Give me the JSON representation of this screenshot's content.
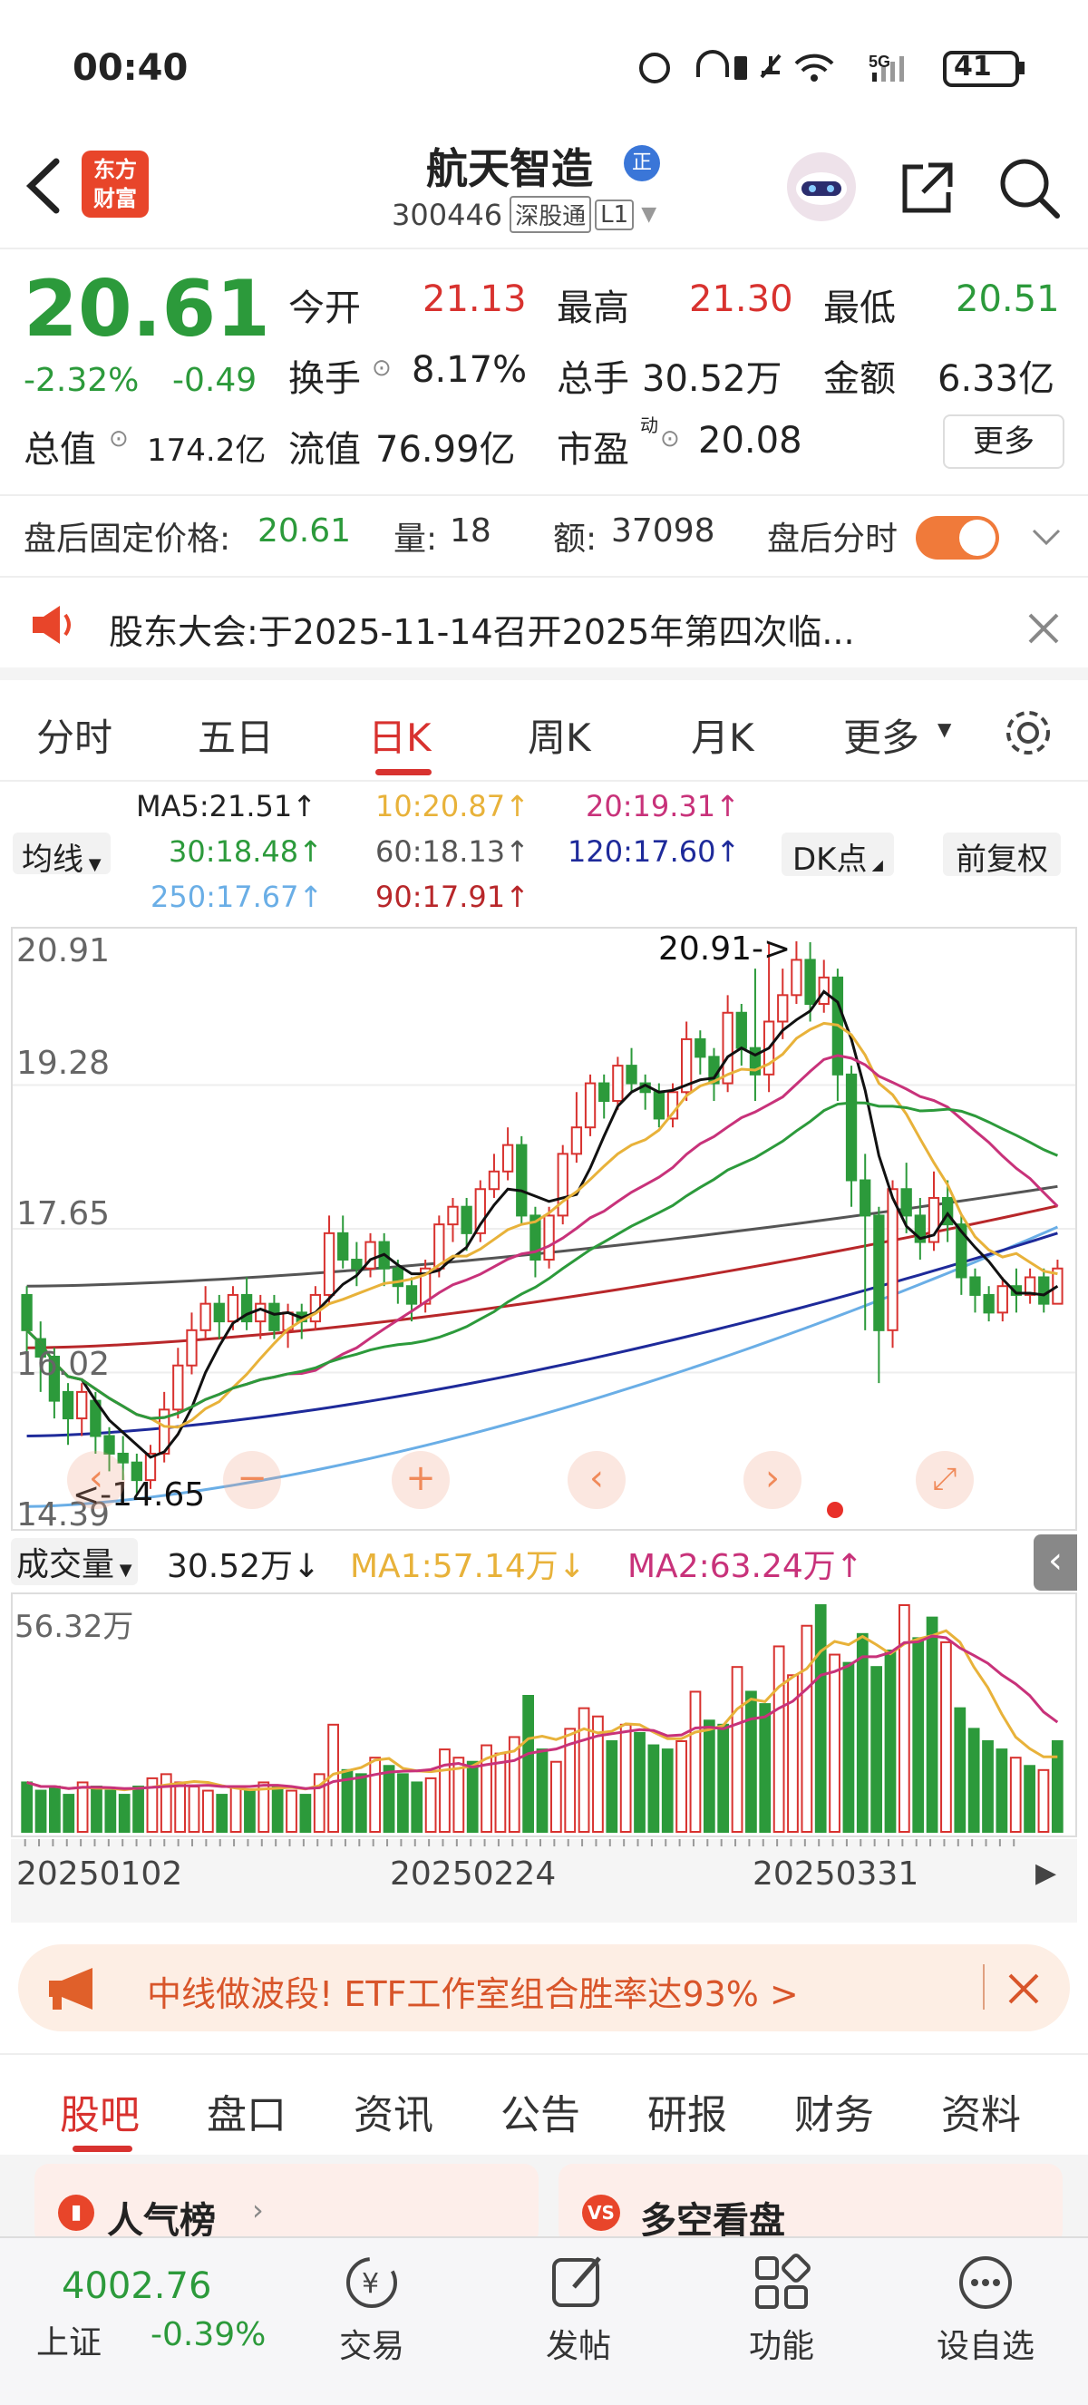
{
  "status": {
    "time": "00:40",
    "battery": "41"
  },
  "header": {
    "logo_line1": "东方",
    "logo_line2": "财富",
    "title": "航天智造",
    "badge": "正",
    "code": "300446",
    "tag1": "深股通",
    "tag2": "L1"
  },
  "quote": {
    "price": "20.61",
    "pct": "-2.32%",
    "chg": "-0.49",
    "open_label": "今开",
    "open": "21.13",
    "high_label": "最高",
    "high": "21.30",
    "low_label": "最低",
    "low": "20.51",
    "turnover_label": "换手",
    "turnover": "8.17%",
    "vol_label": "总手",
    "vol": "30.52万",
    "amount_label": "金额",
    "amount": "6.33亿",
    "mcap_label": "总值",
    "mcap": "174.2亿",
    "float_label": "流值",
    "float": "76.99亿",
    "pe_label": "市盈",
    "pe_sup": "动",
    "pe": "20.08",
    "more": "更多"
  },
  "afterhours": {
    "label": "盘后固定价格:",
    "price": "20.61",
    "vol_label": "量:",
    "vol": "18",
    "amt_label": "额:",
    "amt": "37098",
    "toggle_label": "盘后分时"
  },
  "notice": {
    "text": "股东大会:于2025-11-14召开2025年第四次临..."
  },
  "tabs": {
    "t1": "分时",
    "t2": "五日",
    "t3": "日K",
    "t4": "周K",
    "t5": "月K",
    "t6": "更多"
  },
  "ma": {
    "select": "均线",
    "ma5": "MA5:21.51↑",
    "ma10": "10:20.87↑",
    "ma20": "20:19.31↑",
    "ma30": "30:18.48↑",
    "ma60": "60:18.13↑",
    "ma120": "120:17.60↑",
    "ma250": "250:17.67↑",
    "ma90": "90:17.91↑",
    "dk": "DK点",
    "fq": "前复权"
  },
  "chart_labels": {
    "y1": "20.91",
    "y2": "19.28",
    "y3": "17.65",
    "y4": "16.02",
    "y5": "14.39",
    "maxnote": "20.91->",
    "minnote": "<-14.65"
  },
  "volume": {
    "select": "成交量",
    "val": "30.52万↓",
    "ma1": "MA1:57.14万↓",
    "ma2": "MA2:63.24万↑",
    "ymax": "56.32万",
    "d1": "20250102",
    "d2": "20250224",
    "d3": "20250331"
  },
  "banner": {
    "text": "中线做波段! ETF工作室组合胜率达93% >"
  },
  "subtabs": {
    "s1": "股吧",
    "s2": "盘口",
    "s3": "资讯",
    "s4": "公告",
    "s5": "研报",
    "s6": "财务",
    "s7": "资料"
  },
  "cards": {
    "c1": "人气榜",
    "c2": "多空看盘"
  },
  "bottom": {
    "index_val": "4002.76",
    "index_name": "上证",
    "index_chg": "-0.39%",
    "b1": "交易",
    "b2": "发帖",
    "b3": "功能",
    "b4": "设自选"
  },
  "chart_data": {
    "type": "candlestick",
    "ohlc": [
      [
        16.9,
        16.5,
        17.0,
        16.1
      ],
      [
        16.4,
        16.2,
        16.6,
        15.8
      ],
      [
        16.2,
        15.7,
        16.3,
        15.5
      ],
      [
        15.8,
        15.5,
        15.9,
        15.2
      ],
      [
        15.5,
        15.8,
        15.9,
        15.3
      ],
      [
        15.7,
        15.3,
        15.8,
        15.1
      ],
      [
        15.3,
        15.1,
        15.4,
        14.9
      ],
      [
        15.1,
        15.0,
        15.3,
        14.8
      ],
      [
        15.0,
        14.8,
        15.1,
        14.65
      ],
      [
        14.8,
        15.1,
        15.2,
        14.7
      ],
      [
        15.1,
        15.6,
        15.8,
        15.0
      ],
      [
        15.6,
        16.1,
        16.3,
        15.5
      ],
      [
        16.1,
        16.5,
        16.7,
        16.0
      ],
      [
        16.5,
        16.8,
        17.0,
        16.4
      ],
      [
        16.8,
        16.6,
        16.9,
        16.4
      ],
      [
        16.6,
        16.9,
        17.0,
        16.5
      ],
      [
        16.9,
        16.6,
        17.1,
        16.5
      ],
      [
        16.6,
        16.8,
        16.9,
        16.4
      ],
      [
        16.8,
        16.5,
        16.9,
        16.4
      ],
      [
        16.5,
        16.7,
        16.8,
        16.3
      ],
      [
        16.7,
        16.6,
        16.8,
        16.4
      ],
      [
        16.6,
        16.9,
        17.0,
        16.5
      ],
      [
        16.9,
        17.6,
        17.8,
        16.8
      ],
      [
        17.6,
        17.3,
        17.8,
        17.2
      ],
      [
        17.3,
        17.2,
        17.5,
        17.0
      ],
      [
        17.2,
        17.5,
        17.6,
        17.1
      ],
      [
        17.5,
        17.2,
        17.6,
        17.0
      ],
      [
        17.2,
        17.0,
        17.3,
        16.8
      ],
      [
        17.0,
        16.8,
        17.1,
        16.6
      ],
      [
        16.8,
        17.2,
        17.3,
        16.7
      ],
      [
        17.2,
        17.7,
        17.8,
        17.1
      ],
      [
        17.7,
        17.9,
        18.0,
        17.5
      ],
      [
        17.9,
        17.6,
        18.0,
        17.4
      ],
      [
        17.6,
        18.1,
        18.2,
        17.5
      ],
      [
        18.1,
        18.3,
        18.5,
        18.0
      ],
      [
        18.3,
        18.6,
        18.8,
        18.2
      ],
      [
        18.6,
        17.8,
        18.7,
        17.7
      ],
      [
        17.8,
        17.3,
        17.9,
        17.1
      ],
      [
        17.3,
        17.8,
        17.9,
        17.2
      ],
      [
        17.8,
        18.5,
        18.6,
        17.7
      ],
      [
        18.5,
        18.8,
        19.2,
        18.4
      ],
      [
        18.8,
        19.3,
        19.4,
        18.7
      ],
      [
        19.3,
        19.1,
        19.4,
        18.9
      ],
      [
        19.1,
        19.5,
        19.6,
        19.0
      ],
      [
        19.5,
        19.3,
        19.7,
        19.2
      ],
      [
        19.3,
        19.2,
        19.4,
        19.0
      ],
      [
        19.2,
        18.9,
        19.3,
        18.8
      ],
      [
        18.9,
        19.2,
        19.3,
        18.8
      ],
      [
        19.2,
        19.8,
        20.0,
        19.1
      ],
      [
        19.8,
        19.6,
        19.9,
        19.4
      ],
      [
        19.6,
        19.3,
        19.7,
        19.1
      ],
      [
        19.3,
        20.1,
        20.3,
        19.2
      ],
      [
        20.1,
        19.7,
        20.2,
        19.5
      ],
      [
        19.7,
        19.4,
        20.6,
        19.1
      ],
      [
        19.4,
        20.0,
        20.9,
        19.2
      ],
      [
        20.0,
        20.3,
        20.6,
        19.8
      ],
      [
        20.3,
        20.7,
        20.91,
        20.2
      ],
      [
        20.7,
        20.2,
        20.9,
        20.0
      ],
      [
        20.2,
        20.5,
        20.7,
        20.1
      ],
      [
        20.5,
        19.4,
        20.6,
        19.1
      ],
      [
        19.4,
        18.2,
        19.5,
        17.9
      ],
      [
        18.2,
        17.8,
        18.5,
        16.5
      ],
      [
        17.8,
        16.5,
        17.9,
        15.9
      ],
      [
        16.5,
        18.1,
        18.2,
        16.3
      ],
      [
        18.1,
        17.8,
        18.4,
        17.6
      ],
      [
        17.8,
        17.5,
        18.0,
        17.3
      ],
      [
        17.5,
        18.0,
        18.3,
        17.4
      ],
      [
        18.0,
        17.7,
        18.2,
        17.5
      ],
      [
        17.7,
        17.1,
        17.8,
        16.9
      ],
      [
        17.1,
        16.9,
        17.2,
        16.7
      ],
      [
        16.9,
        16.7,
        17.0,
        16.6
      ],
      [
        16.7,
        17.0,
        17.1,
        16.6
      ],
      [
        17.0,
        16.9,
        17.2,
        16.7
      ],
      [
        16.9,
        17.1,
        17.2,
        16.8
      ],
      [
        17.1,
        16.8,
        17.2,
        16.7
      ],
      [
        16.8,
        17.2,
        17.3,
        16.8
      ]
    ],
    "volume_wan": [
      12,
      10,
      11,
      9,
      12,
      11,
      10,
      9,
      11,
      13,
      14,
      12,
      11,
      10,
      9,
      11,
      10,
      12,
      11,
      10,
      9,
      14,
      26,
      15,
      14,
      18,
      16,
      14,
      12,
      13,
      20,
      18,
      17,
      21,
      19,
      23,
      33,
      20,
      17,
      25,
      30,
      28,
      22,
      26,
      24,
      21,
      20,
      22,
      34,
      27,
      26,
      40,
      34,
      31,
      45,
      38,
      50,
      55,
      43,
      41,
      48,
      40,
      44,
      55,
      47,
      52,
      46,
      30,
      25,
      22,
      20,
      18,
      16,
      15,
      22
    ],
    "ma_lines": {
      "MA5": "21.51",
      "MA10": "20.87",
      "MA20": "19.31",
      "MA30": "18.48",
      "MA60": "18.13",
      "MA90": "17.91",
      "MA120": "17.60",
      "MA250": "17.67"
    },
    "ylim": [
      14.39,
      20.91
    ],
    "high": "20.91",
    "low": "14.65"
  }
}
